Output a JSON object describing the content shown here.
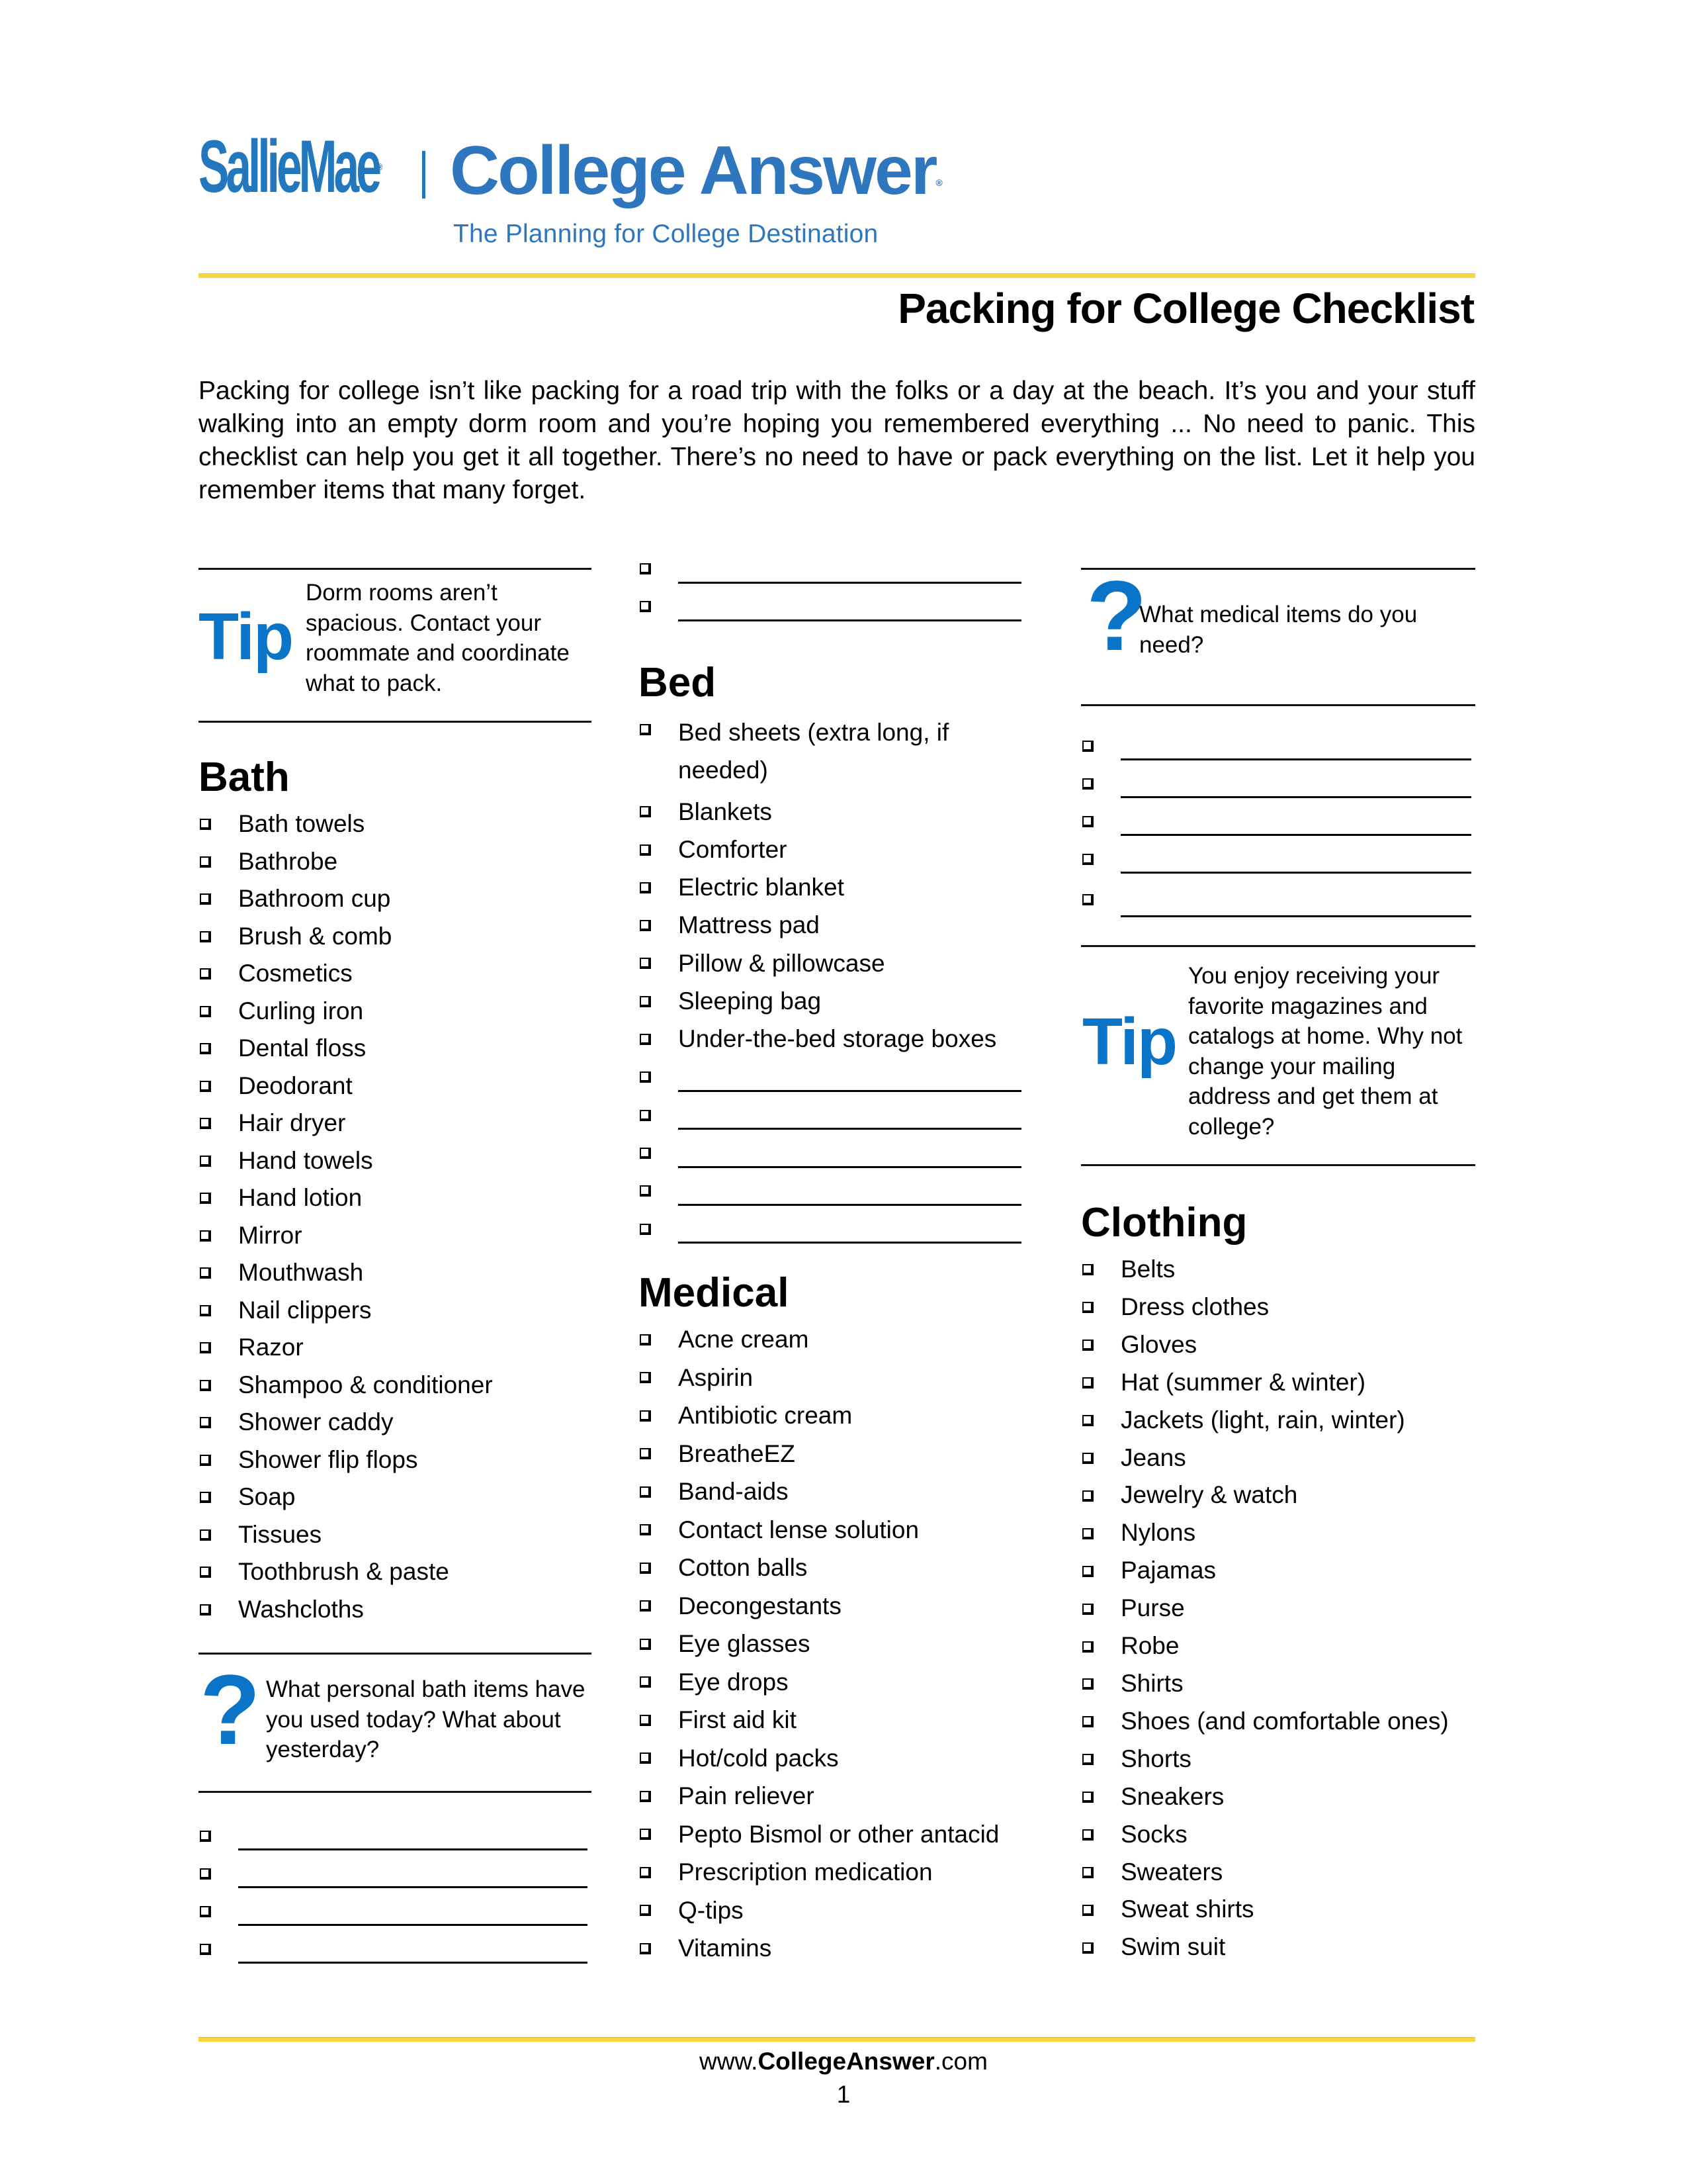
{
  "header": {
    "brand_primary": "SallieMae",
    "brand_primary_mark": "®",
    "brand_secondary": "College Answer",
    "brand_secondary_mark": "®",
    "tagline": "The Planning for College Destination",
    "brand_color": "#2277BD",
    "accent_rule_color": "#F6D83E"
  },
  "title": "Packing for College Checklist",
  "intro": "Packing for college isn’t like packing for a road trip with the folks or a day at the beach. It’s you and your stuff walking into an empty dorm room and you’re hoping you remembered everything ... No need to panic. This checklist can help you get it all together. There’s no need to have or pack everything on the list. Let it help you remember items that many forget.",
  "callout_color": "#0A74C8",
  "column1": {
    "tip": {
      "label": "Tip",
      "text": "Dorm rooms aren’t spacious. Contact your roommate and coordinate what to pack."
    },
    "bath": {
      "heading": "Bath",
      "items": [
        "Bath towels",
        "Bathrobe",
        "Bathroom cup",
        "Brush & comb",
        "Cosmetics",
        "Curling iron",
        "Dental floss",
        "Deodorant",
        "Hair dryer",
        "Hand towels",
        "Hand lotion",
        "Mirror",
        "Mouthwash",
        "Nail clippers",
        "Razor",
        "Shampoo & conditioner",
        "Shower caddy",
        "Shower flip flops",
        "Soap",
        "Tissues",
        "Toothbrush & paste",
        "Washcloths"
      ]
    },
    "question": {
      "label": "?",
      "text": "What personal bath items have you used today? What about yesterday?"
    },
    "blank_count": 4
  },
  "column2": {
    "top_blank_count": 2,
    "bed": {
      "heading": "Bed",
      "items": [
        "Bed sheets (extra long, if needed)",
        "Blankets",
        "Comforter",
        "Electric blanket",
        "Mattress pad",
        "Pillow & pillowcase",
        "Sleeping bag",
        "Under-the-bed storage boxes"
      ],
      "blank_count": 5
    },
    "medical": {
      "heading": "Medical",
      "items": [
        "Acne cream",
        "Aspirin",
        "Antibiotic cream",
        "BreatheEZ",
        "Band-aids",
        "Contact lense solution",
        "Cotton balls",
        "Decongestants",
        "Eye glasses",
        "Eye drops",
        "First aid kit",
        "Hot/cold packs",
        "Pain reliever",
        "Pepto Bismol or other antacid",
        "Prescription medication",
        "Q-tips",
        "Vitamins"
      ]
    }
  },
  "column3": {
    "question": {
      "label": "?",
      "text": "What medical items do you need?"
    },
    "blank_count": 5,
    "tip": {
      "label": "Tip",
      "text": "You enjoy receiving your favorite magazines and catalogs at home. Why not change your mailing address and get them at college?"
    },
    "clothing": {
      "heading": "Clothing",
      "items": [
        "Belts",
        "Dress clothes",
        "Gloves",
        "Hat (summer & winter)",
        "Jackets (light, rain, winter)",
        "Jeans",
        "Jewelry & watch",
        "Nylons",
        "Pajamas",
        "Purse",
        "Robe",
        "Shirts",
        "Shoes (and comfortable ones)",
        "Shorts",
        "Sneakers",
        "Socks",
        "Sweaters",
        "Sweat shirts",
        "Swim suit"
      ]
    }
  },
  "footer": {
    "url_prefix": "www.",
    "url_bold": "CollegeAnswer",
    "url_suffix": ".com",
    "page_number": "1"
  }
}
